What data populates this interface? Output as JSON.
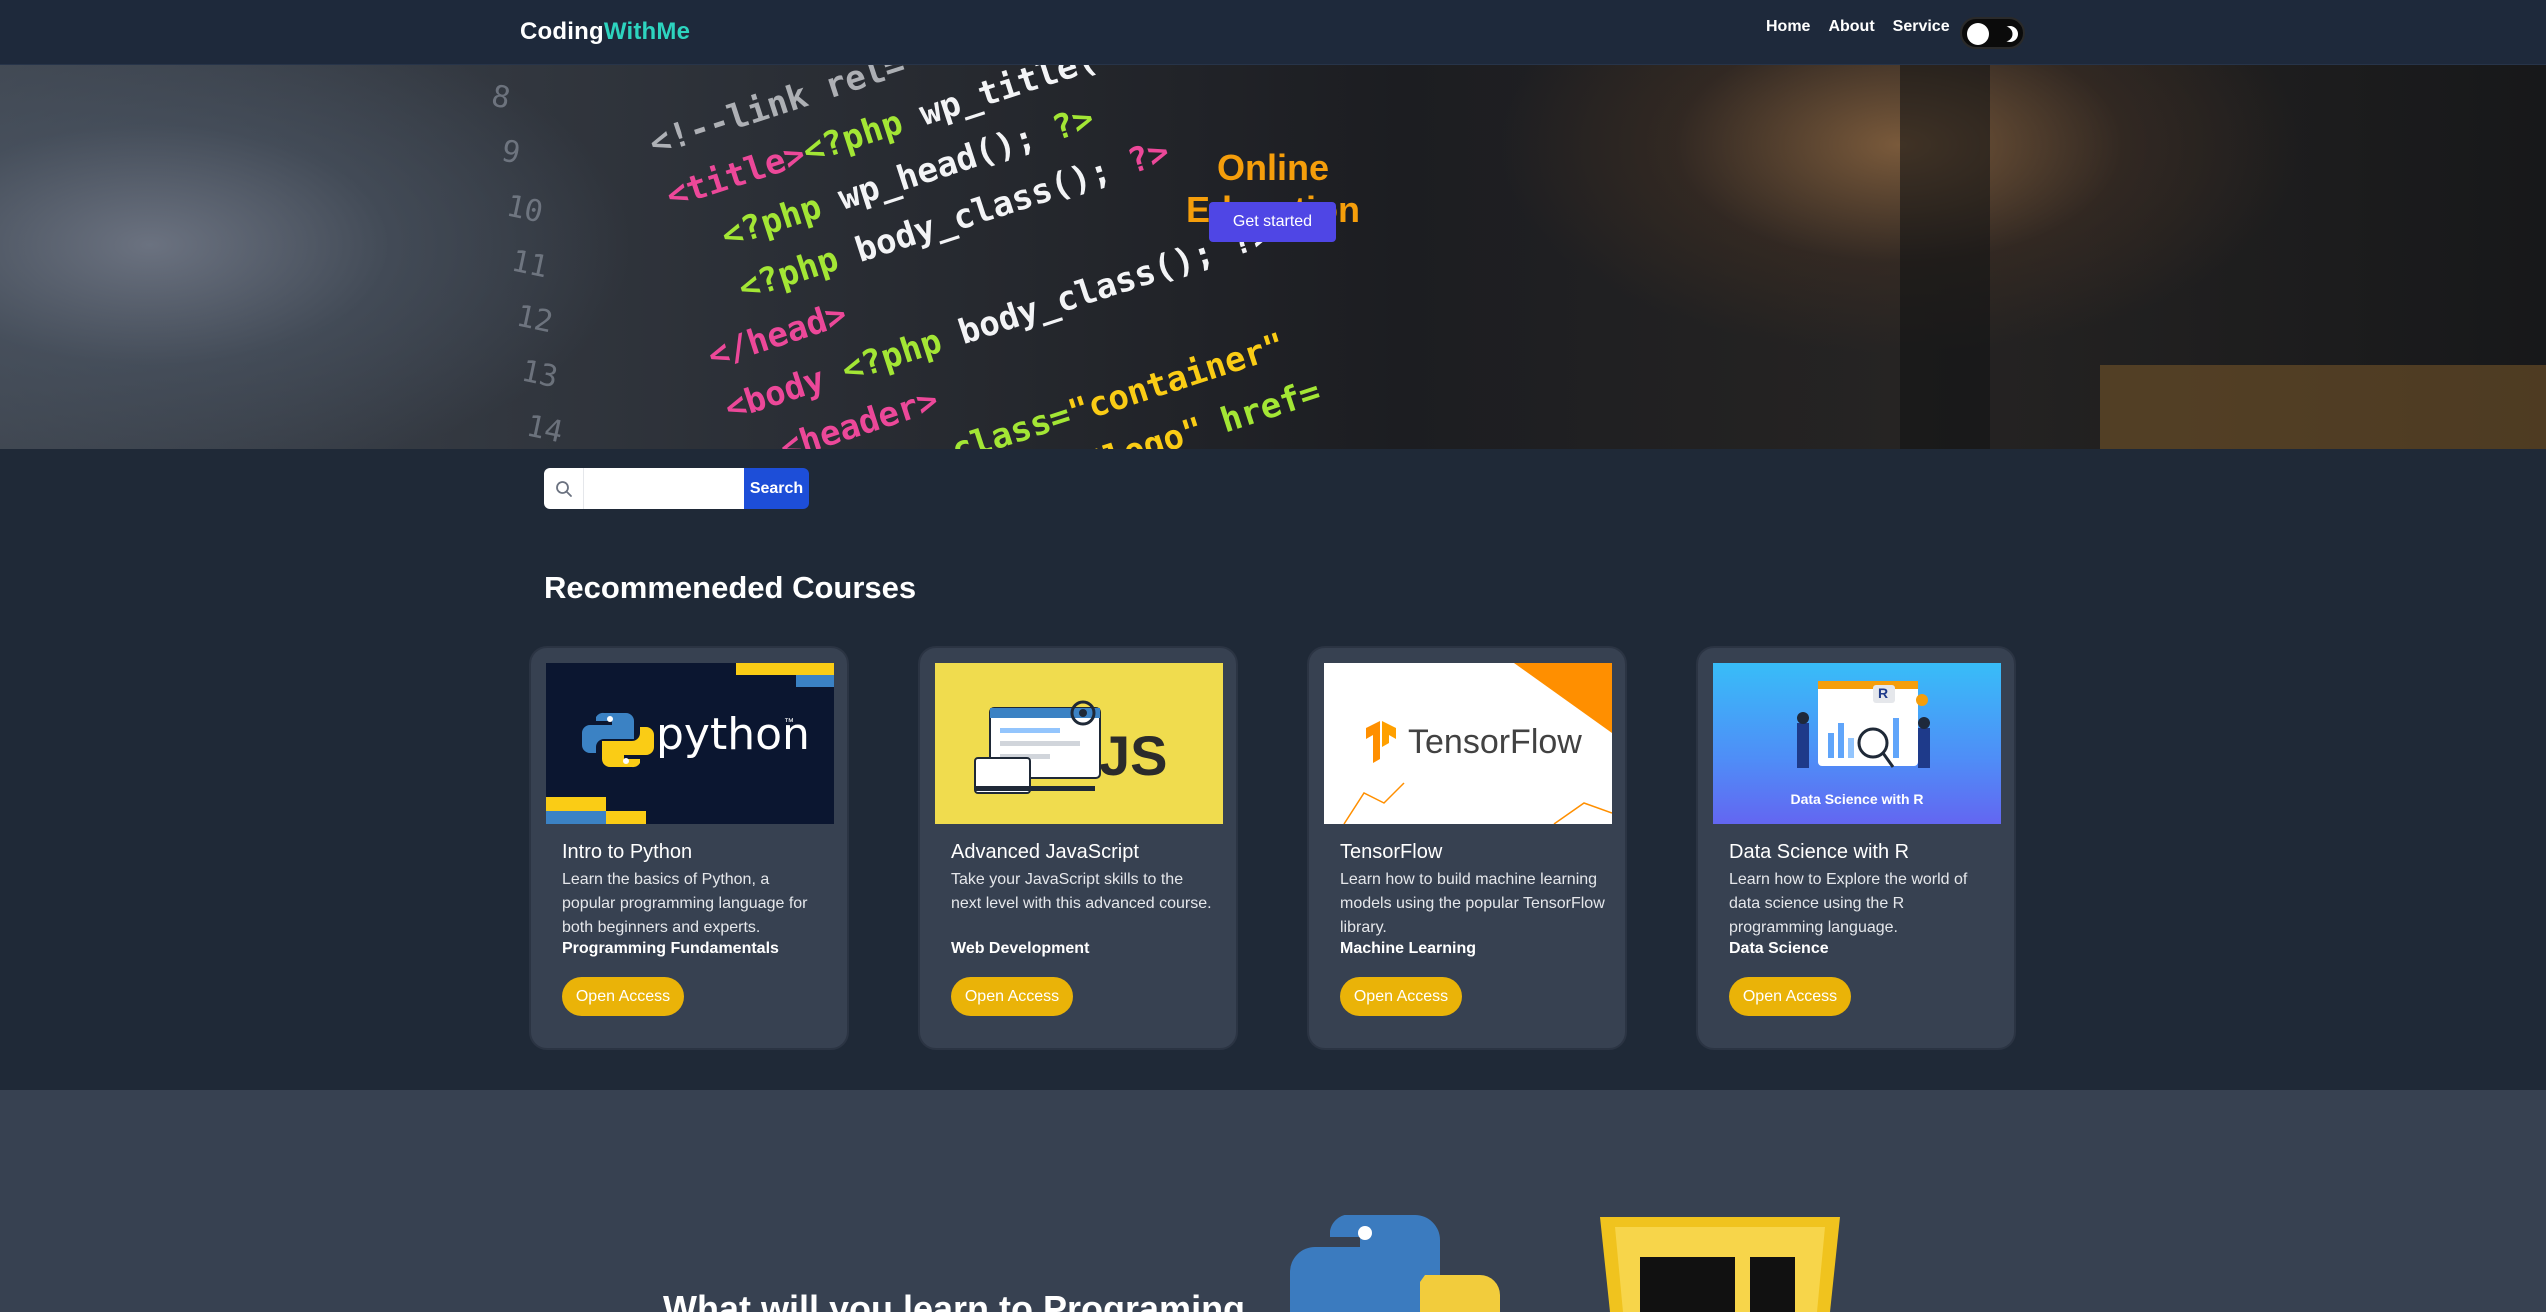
{
  "brand": {
    "part1": "Coding",
    "part2": "WithMe"
  },
  "nav": {
    "items": [
      "Home",
      "About",
      "Service"
    ]
  },
  "hero": {
    "title": "Online Education",
    "button": "Get started"
  },
  "search": {
    "button": "Search",
    "value": ""
  },
  "courses_heading": "Recommeneded Courses",
  "courses": [
    {
      "title": "Intro to Python",
      "description": "Learn the basics of Python, a popular programming language for both beginners and experts.",
      "category": "Programming Fundamentals",
      "button": "Open Access",
      "image_text": "python",
      "image_tm": "™"
    },
    {
      "title": "Advanced JavaScript",
      "description": "Take your JavaScript skills to the next level with this advanced course.",
      "category": "Web Development",
      "button": "Open Access",
      "image_text": "JS"
    },
    {
      "title": "TensorFlow",
      "description": "Learn how to build machine learning models using the popular TensorFlow library.",
      "category": "Machine Learning",
      "button": "Open Access",
      "image_text": "TensorFlow"
    },
    {
      "title": "Data Science with R",
      "description": "Learn how to Explore the world of data science using the R programming language.",
      "category": "Data Science",
      "button": "Open Access",
      "image_text": "Data Science with R",
      "image_badge": "R"
    }
  ],
  "bottom": {
    "title": "What will you learn to Programing"
  },
  "colors": {
    "brand_accent": "#2dd4bf",
    "hero_title": "#f59e0b",
    "primary_button": "#4f46e5",
    "search_button": "#1d4ed8",
    "card_button": "#eab308",
    "background": "#1f2937",
    "card": "#374151"
  },
  "icons": [
    "search-icon",
    "moon-icon",
    "python-logo-icon",
    "tensorflow-logo-icon"
  ]
}
